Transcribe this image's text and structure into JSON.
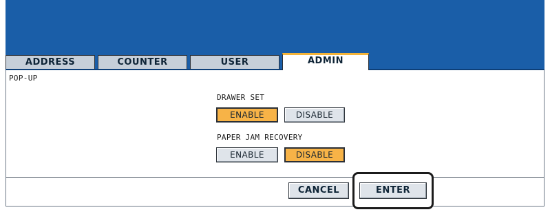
{
  "tabs": [
    {
      "label": "ADDRESS"
    },
    {
      "label": "COUNTER"
    },
    {
      "label": "USER"
    },
    {
      "label": "ADMIN"
    }
  ],
  "page": {
    "title": "POP-UP"
  },
  "settings": {
    "drawer_set": {
      "label": "DRAWER SET",
      "enable": "ENABLE",
      "disable": "DISABLE",
      "selected": "ENABLE"
    },
    "paper_jam_recovery": {
      "label": "PAPER JAM RECOVERY",
      "enable": "ENABLE",
      "disable": "DISABLE",
      "selected": "DISABLE"
    }
  },
  "actions": {
    "cancel": "CANCEL",
    "enter": "ENTER"
  },
  "colors": {
    "header": "#1a5ea8",
    "selected": "#f7b347",
    "active_tab_accent": "#f4b43a",
    "button": "#dfe4ea"
  }
}
